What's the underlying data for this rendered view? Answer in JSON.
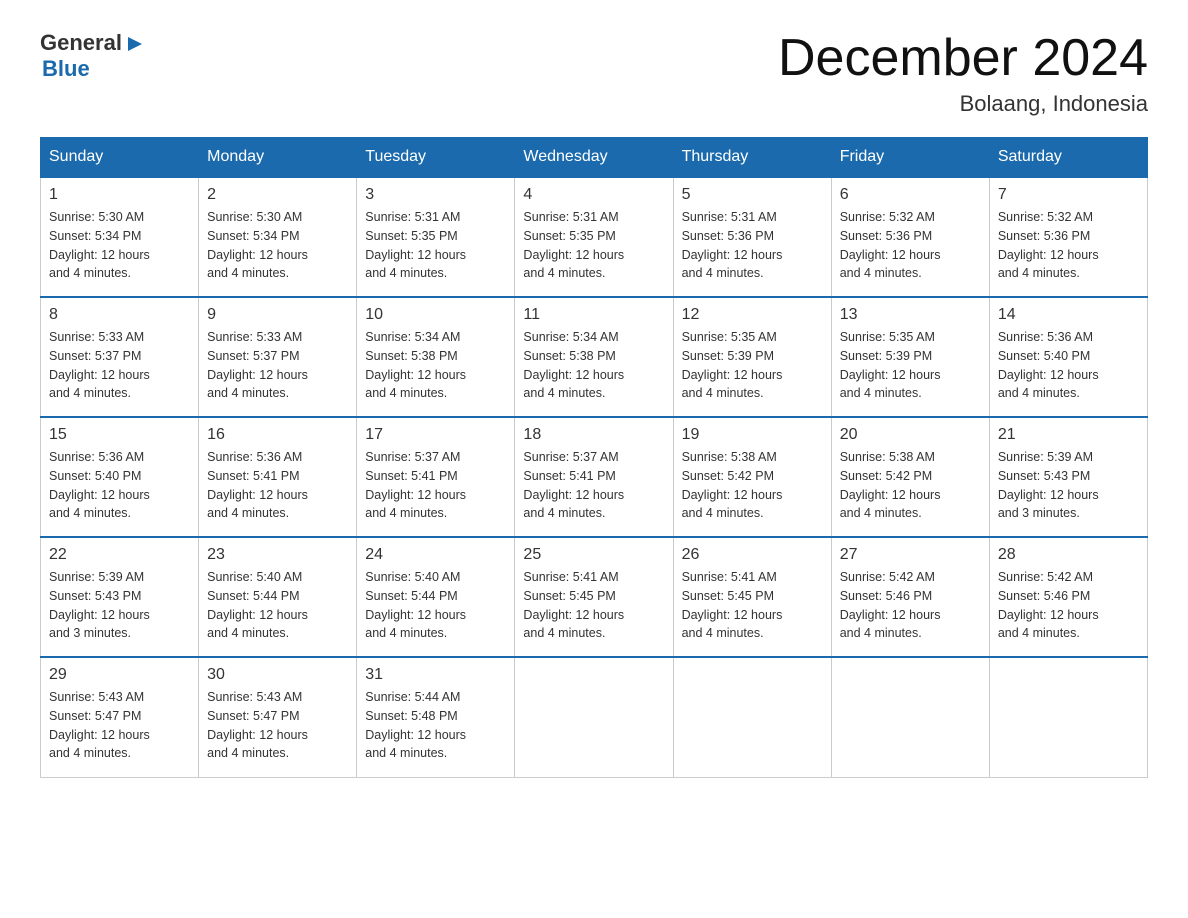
{
  "logo": {
    "text_general": "General",
    "text_blue": "Blue"
  },
  "header": {
    "title": "December 2024",
    "subtitle": "Bolaang, Indonesia"
  },
  "days_of_week": [
    "Sunday",
    "Monday",
    "Tuesday",
    "Wednesday",
    "Thursday",
    "Friday",
    "Saturday"
  ],
  "weeks": [
    [
      {
        "day": "1",
        "sunrise": "5:30 AM",
        "sunset": "5:34 PM",
        "daylight": "12 hours and 4 minutes."
      },
      {
        "day": "2",
        "sunrise": "5:30 AM",
        "sunset": "5:34 PM",
        "daylight": "12 hours and 4 minutes."
      },
      {
        "day": "3",
        "sunrise": "5:31 AM",
        "sunset": "5:35 PM",
        "daylight": "12 hours and 4 minutes."
      },
      {
        "day": "4",
        "sunrise": "5:31 AM",
        "sunset": "5:35 PM",
        "daylight": "12 hours and 4 minutes."
      },
      {
        "day": "5",
        "sunrise": "5:31 AM",
        "sunset": "5:36 PM",
        "daylight": "12 hours and 4 minutes."
      },
      {
        "day": "6",
        "sunrise": "5:32 AM",
        "sunset": "5:36 PM",
        "daylight": "12 hours and 4 minutes."
      },
      {
        "day": "7",
        "sunrise": "5:32 AM",
        "sunset": "5:36 PM",
        "daylight": "12 hours and 4 minutes."
      }
    ],
    [
      {
        "day": "8",
        "sunrise": "5:33 AM",
        "sunset": "5:37 PM",
        "daylight": "12 hours and 4 minutes."
      },
      {
        "day": "9",
        "sunrise": "5:33 AM",
        "sunset": "5:37 PM",
        "daylight": "12 hours and 4 minutes."
      },
      {
        "day": "10",
        "sunrise": "5:34 AM",
        "sunset": "5:38 PM",
        "daylight": "12 hours and 4 minutes."
      },
      {
        "day": "11",
        "sunrise": "5:34 AM",
        "sunset": "5:38 PM",
        "daylight": "12 hours and 4 minutes."
      },
      {
        "day": "12",
        "sunrise": "5:35 AM",
        "sunset": "5:39 PM",
        "daylight": "12 hours and 4 minutes."
      },
      {
        "day": "13",
        "sunrise": "5:35 AM",
        "sunset": "5:39 PM",
        "daylight": "12 hours and 4 minutes."
      },
      {
        "day": "14",
        "sunrise": "5:36 AM",
        "sunset": "5:40 PM",
        "daylight": "12 hours and 4 minutes."
      }
    ],
    [
      {
        "day": "15",
        "sunrise": "5:36 AM",
        "sunset": "5:40 PM",
        "daylight": "12 hours and 4 minutes."
      },
      {
        "day": "16",
        "sunrise": "5:36 AM",
        "sunset": "5:41 PM",
        "daylight": "12 hours and 4 minutes."
      },
      {
        "day": "17",
        "sunrise": "5:37 AM",
        "sunset": "5:41 PM",
        "daylight": "12 hours and 4 minutes."
      },
      {
        "day": "18",
        "sunrise": "5:37 AM",
        "sunset": "5:41 PM",
        "daylight": "12 hours and 4 minutes."
      },
      {
        "day": "19",
        "sunrise": "5:38 AM",
        "sunset": "5:42 PM",
        "daylight": "12 hours and 4 minutes."
      },
      {
        "day": "20",
        "sunrise": "5:38 AM",
        "sunset": "5:42 PM",
        "daylight": "12 hours and 4 minutes."
      },
      {
        "day": "21",
        "sunrise": "5:39 AM",
        "sunset": "5:43 PM",
        "daylight": "12 hours and 3 minutes."
      }
    ],
    [
      {
        "day": "22",
        "sunrise": "5:39 AM",
        "sunset": "5:43 PM",
        "daylight": "12 hours and 3 minutes."
      },
      {
        "day": "23",
        "sunrise": "5:40 AM",
        "sunset": "5:44 PM",
        "daylight": "12 hours and 4 minutes."
      },
      {
        "day": "24",
        "sunrise": "5:40 AM",
        "sunset": "5:44 PM",
        "daylight": "12 hours and 4 minutes."
      },
      {
        "day": "25",
        "sunrise": "5:41 AM",
        "sunset": "5:45 PM",
        "daylight": "12 hours and 4 minutes."
      },
      {
        "day": "26",
        "sunrise": "5:41 AM",
        "sunset": "5:45 PM",
        "daylight": "12 hours and 4 minutes."
      },
      {
        "day": "27",
        "sunrise": "5:42 AM",
        "sunset": "5:46 PM",
        "daylight": "12 hours and 4 minutes."
      },
      {
        "day": "28",
        "sunrise": "5:42 AM",
        "sunset": "5:46 PM",
        "daylight": "12 hours and 4 minutes."
      }
    ],
    [
      {
        "day": "29",
        "sunrise": "5:43 AM",
        "sunset": "5:47 PM",
        "daylight": "12 hours and 4 minutes."
      },
      {
        "day": "30",
        "sunrise": "5:43 AM",
        "sunset": "5:47 PM",
        "daylight": "12 hours and 4 minutes."
      },
      {
        "day": "31",
        "sunrise": "5:44 AM",
        "sunset": "5:48 PM",
        "daylight": "12 hours and 4 minutes."
      },
      null,
      null,
      null,
      null
    ]
  ],
  "labels": {
    "sunrise": "Sunrise:",
    "sunset": "Sunset:",
    "daylight": "Daylight:"
  }
}
